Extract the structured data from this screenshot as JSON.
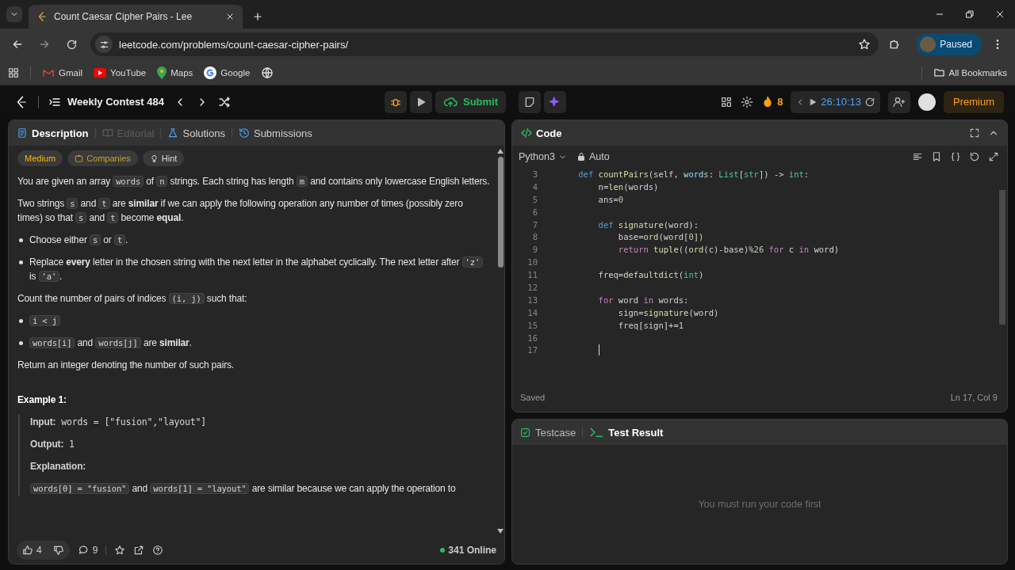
{
  "browser": {
    "tab": {
      "title": "Count Caesar Cipher Pairs - Lee"
    },
    "url": "leetcode.com/problems/count-caesar-cipher-pairs/",
    "profile": "Paused",
    "bookmarks": [
      {
        "kind": "gmail",
        "label": "Gmail"
      },
      {
        "kind": "youtube",
        "label": "YouTube"
      },
      {
        "kind": "maps",
        "label": "Maps"
      },
      {
        "kind": "google",
        "label": "Google"
      },
      {
        "kind": "globe"
      }
    ],
    "all_bookmarks": "All Bookmarks"
  },
  "app_bar": {
    "contest": "Weekly Contest 484",
    "submit": "Submit",
    "streak": "8",
    "timer": "26:10:13",
    "premium": "Premium"
  },
  "description_panel": {
    "tabs": [
      {
        "kind": "doc",
        "label": "Description",
        "selected": true,
        "disabled": false
      },
      {
        "kind": "book",
        "label": "Editorial",
        "selected": false,
        "disabled": true
      },
      {
        "kind": "flask",
        "label": "Solutions",
        "selected": false,
        "disabled": false
      },
      {
        "kind": "history",
        "label": "Submissions",
        "selected": false,
        "disabled": false
      }
    ],
    "tags": [
      {
        "kind": "difficulty",
        "label": "Medium"
      },
      {
        "kind": "companies",
        "label": "Companies"
      },
      {
        "kind": "hint",
        "label": "Hint"
      }
    ],
    "blocks": [
      {
        "kind": "para",
        "parts": [
          {
            "kind": "text",
            "text": "You are given an array "
          },
          {
            "kind": "code",
            "text": "words"
          },
          {
            "kind": "text",
            "text": " of "
          },
          {
            "kind": "code",
            "text": "n"
          },
          {
            "kind": "text",
            "text": " strings. Each string has length "
          },
          {
            "kind": "code",
            "text": "m"
          },
          {
            "kind": "text",
            "text": " and contains only lowercase English letters."
          }
        ]
      },
      {
        "kind": "para",
        "parts": [
          {
            "kind": "text",
            "text": "Two strings "
          },
          {
            "kind": "code",
            "text": "s"
          },
          {
            "kind": "text",
            "text": " and "
          },
          {
            "kind": "code",
            "text": "t"
          },
          {
            "kind": "text",
            "text": " are **similar** if we can apply the following operation any number of times (possibly zero times) so that "
          },
          {
            "kind": "code",
            "text": "s"
          },
          {
            "kind": "text",
            "text": " and "
          },
          {
            "kind": "code",
            "text": "t"
          },
          {
            "kind": "text",
            "text": " become **equal**."
          }
        ]
      },
      {
        "kind": "bullet",
        "parts": [
          {
            "kind": "text",
            "text": "Choose either "
          },
          {
            "kind": "code",
            "text": "s"
          },
          {
            "kind": "text",
            "text": " or "
          },
          {
            "kind": "code",
            "text": "t"
          },
          {
            "kind": "text",
            "text": "."
          }
        ]
      },
      {
        "kind": "bullet",
        "parts": [
          {
            "kind": "text",
            "text": "Replace **every** letter in the chosen string with the next letter in the alphabet cyclically. The next letter after "
          },
          {
            "kind": "code",
            "text": "'z'"
          },
          {
            "kind": "text",
            "text": " is "
          },
          {
            "kind": "code",
            "text": "'a'"
          },
          {
            "kind": "text",
            "text": "."
          }
        ]
      },
      {
        "kind": "para",
        "parts": [
          {
            "kind": "text",
            "text": "Count the number of pairs of indices "
          },
          {
            "kind": "code",
            "text": "(i, j)"
          },
          {
            "kind": "text",
            "text": " such that:"
          }
        ]
      },
      {
        "kind": "bullet",
        "parts": [
          {
            "kind": "code",
            "text": "i < j"
          }
        ]
      },
      {
        "kind": "bullet",
        "parts": [
          {
            "kind": "code",
            "text": "words[i]"
          },
          {
            "kind": "text",
            "text": " and "
          },
          {
            "kind": "code",
            "text": "words[j]"
          },
          {
            "kind": "text",
            "text": " are **similar**."
          }
        ]
      },
      {
        "kind": "para",
        "parts": [
          {
            "kind": "text",
            "text": "Return an integer denoting the number of such pairs."
          }
        ]
      },
      {
        "kind": "heading",
        "parts": [
          {
            "kind": "text",
            "text": "Example 1:"
          }
        ]
      },
      {
        "kind": "example",
        "lines": [
          {
            "parts": [
              {
                "kind": "label",
                "text": "Input:"
              },
              {
                "kind": "mono",
                "text": " words = [\"fusion\",\"layout\"]"
              }
            ]
          },
          {
            "parts": [
              {
                "kind": "label",
                "text": "Output:"
              },
              {
                "kind": "mono",
                "text": " 1"
              }
            ]
          },
          {
            "parts": [
              {
                "kind": "label",
                "text": "Explanation:"
              }
            ]
          },
          {
            "parts": [
              {
                "kind": "code",
                "text": "words[0] = \"fusion\""
              },
              {
                "kind": "text",
                "text": " and "
              },
              {
                "kind": "code",
                "text": "words[1] = \"layout\""
              },
              {
                "kind": "text",
                "text": " are similar because we can apply the operation to"
              }
            ]
          }
        ]
      }
    ],
    "footer": {
      "likes": "4",
      "comments": "9",
      "online": "341 Online"
    }
  },
  "code_panel": {
    "title": "Code",
    "language": "Python3",
    "mode": "Auto",
    "lines": [
      {
        "num": "3",
        "tokens": [
          {
            "kind": "kw",
            "text": "    def "
          },
          {
            "kind": "fn",
            "text": "countPairs"
          },
          {
            "kind": "p",
            "text": "(self, "
          },
          {
            "kind": "var",
            "text": "words"
          },
          {
            "kind": "p",
            "text": ": "
          },
          {
            "kind": "ty",
            "text": "List"
          },
          {
            "kind": "p",
            "text": "["
          },
          {
            "kind": "ty",
            "text": "str"
          },
          {
            "kind": "p",
            "text": "]) -> "
          },
          {
            "kind": "ty",
            "text": "int"
          },
          {
            "kind": "p",
            "text": ":"
          }
        ]
      },
      {
        "num": "4",
        "tokens": [
          {
            "kind": "p",
            "text": "        n="
          },
          {
            "kind": "fn",
            "text": "len"
          },
          {
            "kind": "p",
            "text": "(words)"
          }
        ]
      },
      {
        "num": "5",
        "tokens": [
          {
            "kind": "p",
            "text": "        ans="
          },
          {
            "kind": "num",
            "text": "0"
          }
        ]
      },
      {
        "num": "6"
      },
      {
        "num": "7",
        "tokens": [
          {
            "kind": "kw",
            "text": "        def "
          },
          {
            "kind": "fn",
            "text": "signature"
          },
          {
            "kind": "p",
            "text": "(word):"
          }
        ]
      },
      {
        "num": "8",
        "tokens": [
          {
            "kind": "p",
            "text": "            base="
          },
          {
            "kind": "fn",
            "text": "ord"
          },
          {
            "kind": "p",
            "text": "(word["
          },
          {
            "kind": "num",
            "text": "0"
          },
          {
            "kind": "p",
            "text": "])"
          }
        ]
      },
      {
        "num": "9",
        "tokens": [
          {
            "kind": "ctl",
            "text": "            return "
          },
          {
            "kind": "fn",
            "text": "tuple"
          },
          {
            "kind": "p",
            "text": "(("
          },
          {
            "kind": "fn",
            "text": "ord"
          },
          {
            "kind": "p",
            "text": "(c)-base)%"
          },
          {
            "kind": "num",
            "text": "26"
          },
          {
            "kind": "ctl",
            "text": " for"
          },
          {
            "kind": "p",
            "text": " c "
          },
          {
            "kind": "ctl",
            "text": "in"
          },
          {
            "kind": "p",
            "text": " word)"
          }
        ]
      },
      {
        "num": "10"
      },
      {
        "num": "11",
        "tokens": [
          {
            "kind": "p",
            "text": "        freq="
          },
          {
            "kind": "fn",
            "text": "defaultdict"
          },
          {
            "kind": "p",
            "text": "("
          },
          {
            "kind": "ty",
            "text": "int"
          },
          {
            "kind": "p",
            "text": ")"
          }
        ]
      },
      {
        "num": "12"
      },
      {
        "num": "13",
        "tokens": [
          {
            "kind": "ctl",
            "text": "        for"
          },
          {
            "kind": "p",
            "text": " word "
          },
          {
            "kind": "ctl",
            "text": "in"
          },
          {
            "kind": "p",
            "text": " words:"
          }
        ]
      },
      {
        "num": "14",
        "tokens": [
          {
            "kind": "p",
            "text": "            sign="
          },
          {
            "kind": "fn",
            "text": "signature"
          },
          {
            "kind": "p",
            "text": "(word)"
          }
        ]
      },
      {
        "num": "15",
        "tokens": [
          {
            "kind": "p",
            "text": "            freq[sign]+="
          },
          {
            "kind": "num",
            "text": "1"
          }
        ]
      },
      {
        "num": "16"
      },
      {
        "num": "17",
        "cursor": true
      }
    ],
    "status": "Saved",
    "position": "Ln 17, Col 9"
  },
  "result_panel": {
    "tabs": [
      {
        "kind": "testcase",
        "label": "Testcase",
        "selected": false
      },
      {
        "kind": "terminal",
        "label": "Test Result",
        "selected": true
      }
    ],
    "message": "You must run your code first"
  }
}
